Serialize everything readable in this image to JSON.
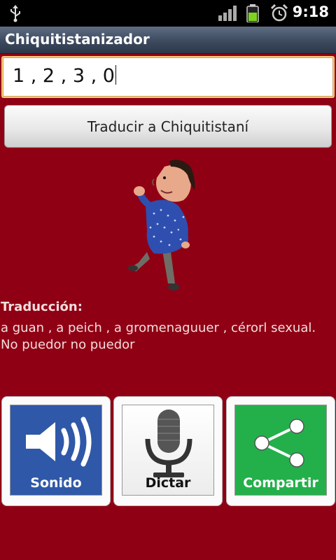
{
  "status_bar": {
    "time": "9:18"
  },
  "app": {
    "title": "Chiquitistanizador"
  },
  "input": {
    "value": "1 , 2 , 3 , 0"
  },
  "translate_button": {
    "label": "Traducir a Chiquitistaní"
  },
  "translation": {
    "label": "Traducción:",
    "text": "a guan  , a peich  , a gromenaguuer  , cérorl sexual. No puedor no puedor"
  },
  "actions": {
    "sound": {
      "label": "Sonido",
      "color": "#2f58a8"
    },
    "dictate": {
      "label": "Dictar"
    },
    "share": {
      "label": "Compartir",
      "color": "#23b04b"
    }
  },
  "icons": [
    "usb-icon",
    "signal-icon",
    "battery-icon",
    "alarm-icon",
    "speaker-icon",
    "microphone-icon",
    "share-icon"
  ]
}
